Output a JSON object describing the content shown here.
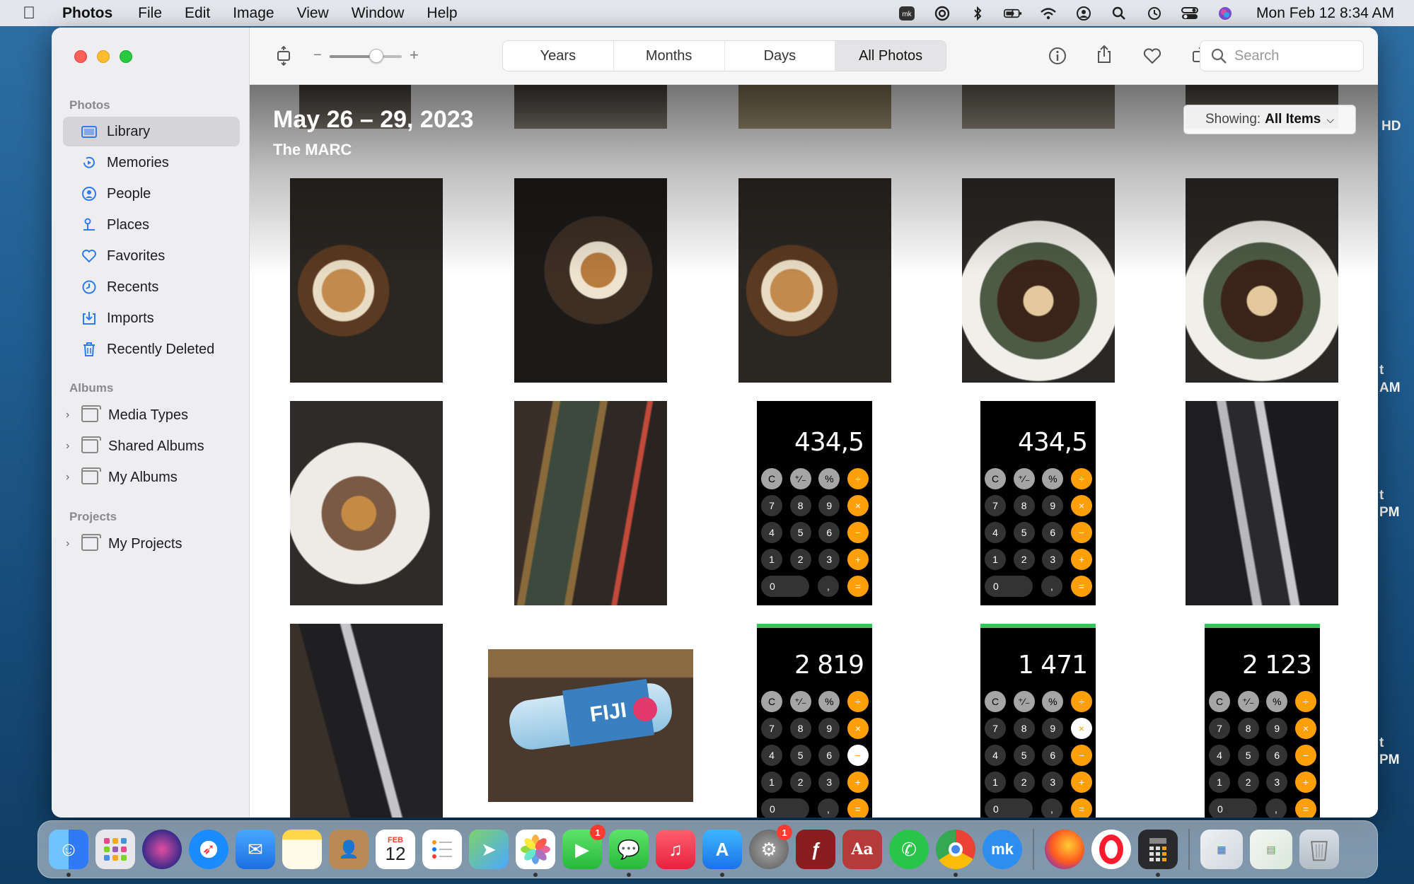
{
  "menubar": {
    "app_name": "Photos",
    "items": [
      "File",
      "Edit",
      "Image",
      "View",
      "Window",
      "Help"
    ],
    "clock": "Mon Feb 12  8:34 AM",
    "status_icons": [
      "app-icon",
      "creative-cloud-icon",
      "bluetooth-icon",
      "battery-icon",
      "wifi-icon",
      "user-icon",
      "search-icon",
      "time-machine-icon",
      "control-center-icon",
      "siri-icon"
    ]
  },
  "desktop_fragments": [
    "HD",
    "t",
    "AM",
    "t",
    "PM",
    "t",
    "PM"
  ],
  "sidebar": {
    "photos_section": "Photos",
    "items": [
      {
        "label": "Library",
        "icon": "library-icon"
      },
      {
        "label": "Memories",
        "icon": "memories-icon"
      },
      {
        "label": "People",
        "icon": "people-icon"
      },
      {
        "label": "Places",
        "icon": "places-icon"
      },
      {
        "label": "Favorites",
        "icon": "heart-icon"
      },
      {
        "label": "Recents",
        "icon": "clock-icon"
      },
      {
        "label": "Imports",
        "icon": "import-icon"
      },
      {
        "label": "Recently Deleted",
        "icon": "trash-icon"
      }
    ],
    "albums_section": "Albums",
    "albums": [
      "Media Types",
      "Shared Albums",
      "My Albums"
    ],
    "projects_section": "Projects",
    "projects": [
      "My Projects"
    ]
  },
  "toolbar": {
    "zoom_minus": "−",
    "zoom_plus": "+",
    "zoom_level": 0.68,
    "segments": [
      "Years",
      "Months",
      "Days",
      "All Photos"
    ],
    "active_segment": "All Photos",
    "search_placeholder": "Search"
  },
  "content": {
    "moment_title": "May 26 – 29, 2023",
    "moment_subtitle": "The MARC",
    "showing_label": "Showing:",
    "showing_value": "All Items",
    "calculators": [
      {
        "display": "434,5"
      },
      {
        "display": "434,5"
      },
      {
        "display": "2 819"
      },
      {
        "display": "1 471"
      },
      {
        "display": "2 123"
      }
    ],
    "calc_keys": [
      [
        "C",
        "⁺⁄₋",
        "%",
        "÷"
      ],
      [
        "7",
        "8",
        "9",
        "×"
      ],
      [
        "4",
        "5",
        "6",
        "−"
      ],
      [
        "1",
        "2",
        "3",
        "+"
      ],
      [
        "0",
        ",",
        "="
      ]
    ],
    "bottle_label": "FIJI"
  },
  "dock": {
    "calendar_month": "FEB",
    "calendar_day": "12",
    "facetime_badge": "1",
    "settings_badge": "1"
  }
}
